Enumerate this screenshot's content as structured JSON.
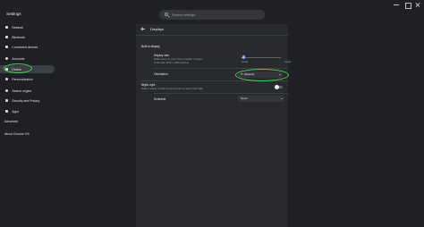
{
  "window": {
    "title": "Settings"
  },
  "search": {
    "placeholder": "Search settings",
    "value": ""
  },
  "sidebar": {
    "items": [
      {
        "label": "Network",
        "icon": "wifi-icon"
      },
      {
        "label": "Bluetooth",
        "icon": "bluetooth-icon"
      },
      {
        "label": "Connected devices",
        "icon": "phone-icon"
      },
      {
        "label": "Accounts",
        "icon": "person-icon"
      },
      {
        "label": "Device",
        "icon": "laptop-icon"
      },
      {
        "label": "Personalization",
        "icon": "brush-icon"
      },
      {
        "label": "Search engine",
        "icon": "search-icon"
      },
      {
        "label": "Security and Privacy",
        "icon": "shield-icon"
      },
      {
        "label": "Apps",
        "icon": "apps-icon"
      }
    ],
    "active_item": "Device",
    "advanced_label": "Advanced",
    "about_label": "About Chrome OS"
  },
  "main": {
    "title": "Displays",
    "section_title": "Built-in display",
    "display_size": {
      "label": "Display size",
      "description_line1": "Make items on your screen smaller or larger",
      "description_line2": "Looks like 1920 x 1080 (Native)",
      "min_label": "Small",
      "max_label": "Large",
      "level": 0.05
    },
    "orientation": {
      "label": "Orientation",
      "selected": "0° (Default)"
    },
    "night_light": {
      "label": "Night Light",
      "description": "Make it easier to look at your screen or read in dim light",
      "enabled": false
    },
    "schedule": {
      "label": "Schedule",
      "selected": "Never"
    }
  },
  "colors": {
    "background": "#1f2023",
    "panel": "#292a2d",
    "accent": "#8ab4f8",
    "annotation": "#3ecf57"
  }
}
